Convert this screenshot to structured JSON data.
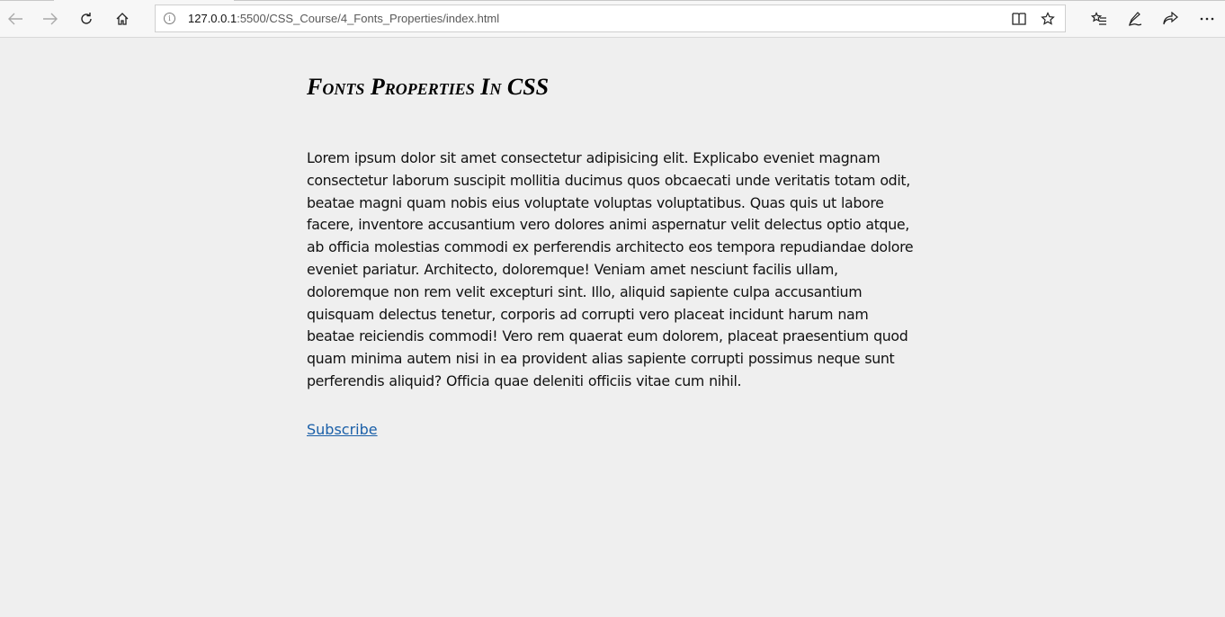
{
  "browser": {
    "url_host": "127.0.0.1",
    "url_path": ":5500/CSS_Course/4_Fonts_Properties/index.html",
    "icons": {
      "back": "back-arrow-icon",
      "forward": "forward-arrow-icon",
      "refresh": "refresh-icon",
      "home": "home-icon",
      "info": "info-icon",
      "reading_view": "reading-view-icon",
      "favorite": "star-icon",
      "favorites_hub": "favorites-list-icon",
      "pen": "pen-icon",
      "share": "share-icon",
      "more": "more-icon"
    }
  },
  "page": {
    "heading": "Fonts Properties In CSS",
    "paragraph": "Lorem ipsum dolor sit amet consectetur adipisicing elit. Explicabo eveniet magnam consectetur laborum suscipit mollitia ducimus quos obcaecati unde veritatis totam odit, beatae magni quam nobis eius voluptate voluptas voluptatibus. Quas quis ut labore facere, inventore accusantium vero dolores animi aspernatur velit delectus optio atque, ab officia molestias commodi ex perferendis architecto eos tempora repudiandae dolore eveniet pariatur. Architecto, doloremque! Veniam amet nesciunt facilis ullam, doloremque non rem velit excepturi sint. Illo, aliquid sapiente culpa accusantium quisquam delectus tenetur, corporis ad corrupti vero placeat incidunt harum nam beatae reiciendis commodi! Vero rem quaerat eum dolorem, placeat praesentium quod quam minima autem nisi in ea provident alias sapiente corrupti possimus neque sunt perferendis aliquid? Officia quae deleniti officiis vitae cum nihil.",
    "link_label": "Subscribe"
  },
  "colors": {
    "page_background": "#efefef",
    "link": "#1a5fa8",
    "text": "#111111"
  }
}
